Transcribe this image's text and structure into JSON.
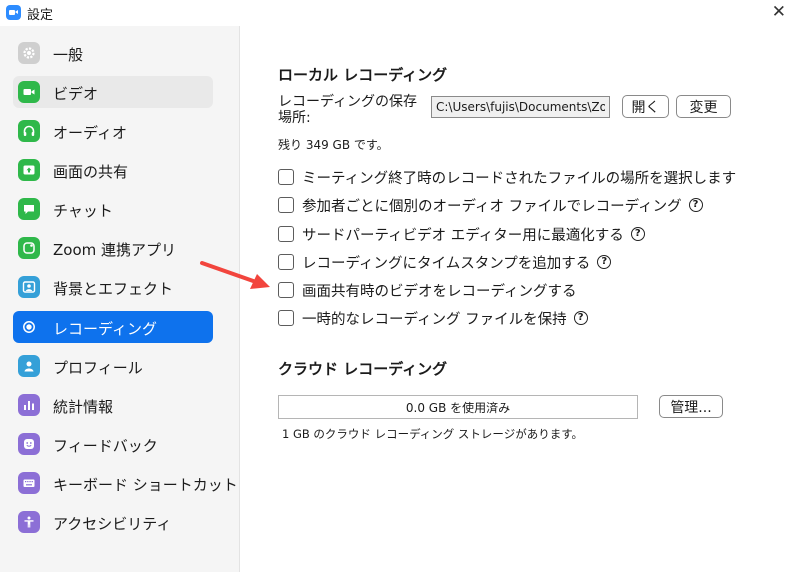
{
  "window": {
    "title": "設定",
    "close_glyph": "✕"
  },
  "sidebar": {
    "items": [
      {
        "label": "一般",
        "icon": "gear-icon",
        "color": "#cfcfcf"
      },
      {
        "label": "ビデオ",
        "icon": "video-icon",
        "color": "#2fb84a"
      },
      {
        "label": "オーディオ",
        "icon": "headphones-icon",
        "color": "#2fb84a"
      },
      {
        "label": "画面の共有",
        "icon": "share-screen-icon",
        "color": "#2fb84a"
      },
      {
        "label": "チャット",
        "icon": "chat-icon",
        "color": "#2fb84a"
      },
      {
        "label": "Zoom 連携アプリ",
        "icon": "apps-icon",
        "color": "#2fb84a"
      },
      {
        "label": "背景とエフェクト",
        "icon": "background-icon",
        "color": "#35a0d8"
      },
      {
        "label": "レコーディング",
        "icon": "record-icon",
        "color": "#0e72ed"
      },
      {
        "label": "プロフィール",
        "icon": "profile-icon",
        "color": "#35a0d8"
      },
      {
        "label": "統計情報",
        "icon": "statistics-icon",
        "color": "#8c6fd6"
      },
      {
        "label": "フィードバック",
        "icon": "feedback-icon",
        "color": "#8c6fd6"
      },
      {
        "label": "キーボード ショートカット",
        "icon": "keyboard-icon",
        "color": "#8c6fd6"
      },
      {
        "label": "アクセシビリティ",
        "icon": "accessibility-icon",
        "color": "#8c6fd6"
      }
    ],
    "selected_index": 7,
    "hovered_index": 1
  },
  "local": {
    "title": "ローカル レコーディング",
    "location_label": "レコーディングの保存場所:",
    "path_value": "C:\\Users\\fujis\\Documents\\Zoom",
    "open_button": "開く",
    "change_button": "変更",
    "free_space": "残り 349 GB です。",
    "options": [
      {
        "label": "ミーティング終了時のレコードされたファイルの場所を選択します",
        "checked": false,
        "help": false
      },
      {
        "label": "参加者ごとに個別のオーディオ ファイルでレコーディング",
        "checked": false,
        "help": true
      },
      {
        "label": "サードパーティビデオ エディター用に最適化する",
        "checked": false,
        "help": true
      },
      {
        "label": "レコーディングにタイムスタンプを追加する",
        "checked": false,
        "help": true
      },
      {
        "label": "画面共有時のビデオをレコーディングする",
        "checked": false,
        "help": false
      },
      {
        "label": "一時的なレコーディング ファイルを保持",
        "checked": false,
        "help": true
      }
    ],
    "help_glyph": "?"
  },
  "cloud": {
    "title": "クラウド レコーディング",
    "usage": "0.0 GB を使用済み",
    "usage_fraction": 0.0,
    "manage_button": "管理...",
    "storage_note": "1 GB のクラウド レコーディング ストレージがあります。"
  },
  "annotation": {
    "arrow_color": "#f2453d"
  }
}
